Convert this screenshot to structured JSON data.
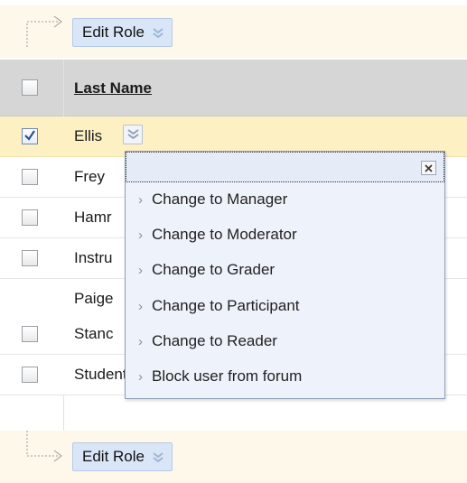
{
  "action_bar": {
    "top_button_label": "Edit Role",
    "bottom_button_label": "Edit Role"
  },
  "table": {
    "header": {
      "last_name_label": "Last Name"
    },
    "rows": [
      {
        "name": "Ellis",
        "checked": true
      },
      {
        "name": "Frey",
        "checked": false
      },
      {
        "name": "Hamr",
        "checked": false
      },
      {
        "name": "Instru",
        "checked": false
      },
      {
        "name": "Paige",
        "checked": false,
        "has_checkbox": false
      },
      {
        "name": "Stanc",
        "checked": false
      },
      {
        "name": "Student",
        "checked": false
      }
    ]
  },
  "role_menu": {
    "items": [
      "Change to Manager",
      "Change to Moderator",
      "Change to Grader",
      "Change to Participant",
      "Change to Reader",
      "Block user from forum"
    ]
  },
  "colors": {
    "action_bar_bg": "#fdf8ea",
    "button_bg": "#d9e6f7",
    "header_bg": "#d6d6d6",
    "selected_row_bg": "#fdf0c2",
    "menu_bg": "#eef2fb"
  }
}
